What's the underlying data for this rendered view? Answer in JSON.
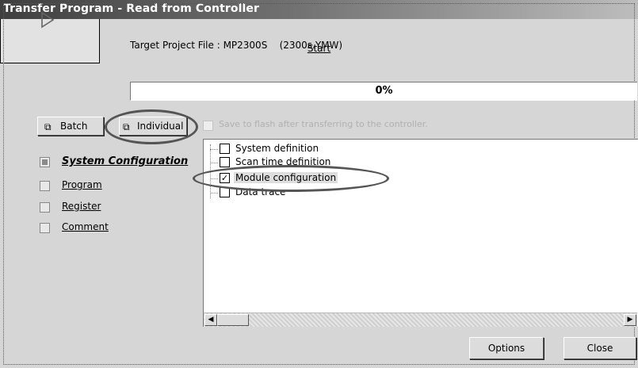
{
  "window": {
    "title": "Transfer Program - Read from Controller"
  },
  "start": {
    "label": "Start",
    "icon": "play-icon"
  },
  "target": {
    "text": "Target Project File : MP2300S    (2300s.YMW)"
  },
  "progress": {
    "value": 0,
    "text": "0%"
  },
  "buttons": {
    "batch": {
      "label": "Batch",
      "icon": "batch-icon"
    },
    "individual": {
      "label": "Individual",
      "icon": "individual-icon"
    }
  },
  "save_flash": {
    "label": "Save to flash after transferring to the controller.",
    "checked": false,
    "enabled": false
  },
  "nav": [
    {
      "label": "System Configuration",
      "active": true
    },
    {
      "label": "Program",
      "active": false
    },
    {
      "label": "Register",
      "active": false
    },
    {
      "label": "Comment",
      "active": false
    }
  ],
  "tree": [
    {
      "label": "System definition",
      "checked": false
    },
    {
      "label": "Scan time definition",
      "checked": false
    },
    {
      "label": "Module configuration",
      "checked": true,
      "selected": true
    },
    {
      "label": "Data trace",
      "checked": false
    }
  ],
  "footer": {
    "options_label": "Options",
    "close_label": "Close"
  }
}
